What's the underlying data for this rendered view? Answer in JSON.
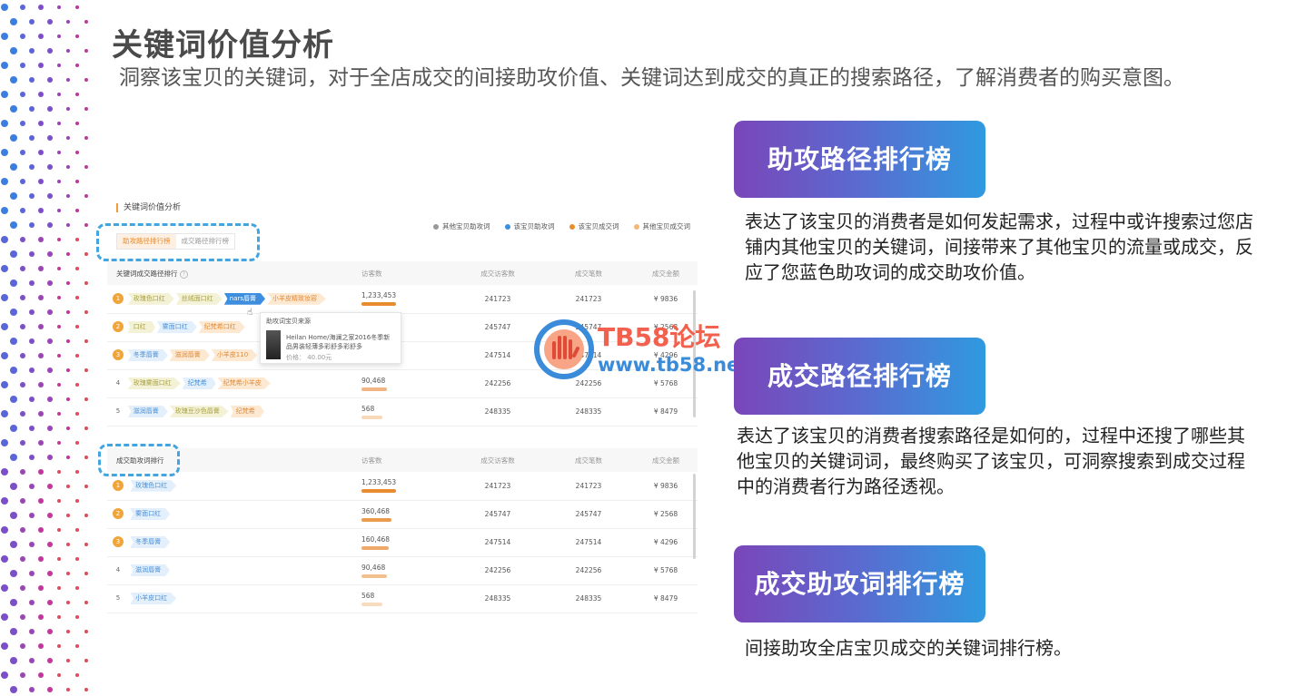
{
  "slide": {
    "title": "关键词价值分析",
    "subtitle": "洞察该宝贝的关键词，对于全店成交的间接助攻价值、关键词达到成交的真正的搜索路径，了解消费者的购买意图。"
  },
  "panel": {
    "title": "关键词价值分析",
    "legend": [
      {
        "label": "其他宝贝助攻词",
        "color": "#999999"
      },
      {
        "label": "该宝贝助攻词",
        "color": "#3d8ede"
      },
      {
        "label": "该宝贝成交词",
        "color": "#e98b2f"
      },
      {
        "label": "其他宝贝成交词",
        "color": "#f2b87a"
      }
    ],
    "tabs": [
      "助攻路径排行榜",
      "成交路径排行榜"
    ],
    "table1": {
      "columns": [
        "关键词成交路径排行",
        "访客数",
        "成交访客数",
        "成交笔数",
        "成交金额"
      ],
      "rows": [
        {
          "rank": "1",
          "chips": [
            [
              "玫瑰色口红",
              "g"
            ],
            [
              "丝绒面口红",
              "g"
            ],
            [
              "nars唇膏",
              "bb"
            ],
            [
              "小羊皮精致妆容",
              "o"
            ]
          ],
          "visitors": "1,233,453",
          "bar": 1.0,
          "buyers": "241723",
          "orders": "241723",
          "amount": "¥ 9836"
        },
        {
          "rank": "2",
          "chips": [
            [
              "口红",
              "g"
            ],
            [
              "雾面口红",
              "b"
            ],
            [
              "纪梵希口红",
              "o"
            ]
          ],
          "visitors": "",
          "bar": 0,
          "buyers": "245747",
          "orders": "245747",
          "amount": "¥ 2568"
        },
        {
          "rank": "3",
          "chips": [
            [
              "冬季唇膏",
              "b"
            ],
            [
              "滋润唇膏",
              "o"
            ],
            [
              "小羊皮110",
              "o"
            ]
          ],
          "visitors": "",
          "bar": 0,
          "buyers": "247514",
          "orders": "247514",
          "amount": "¥ 4296"
        },
        {
          "rank": "4",
          "chips": [
            [
              "玫瑰雾面口红",
              "g"
            ],
            [
              "纪梵希",
              "b"
            ],
            [
              "纪梵希小羊皮",
              "o"
            ]
          ],
          "visitors": "90,468",
          "bar": 0.73,
          "buyers": "242256",
          "orders": "242256",
          "amount": "¥ 5768"
        },
        {
          "rank": "5",
          "chips": [
            [
              "滋润唇膏",
              "b"
            ],
            [
              "玫瑰豆沙色唇膏",
              "g"
            ],
            [
              "纪梵希",
              "o"
            ]
          ],
          "visitors": "568",
          "bar": 0.6,
          "buyers": "248335",
          "orders": "248335",
          "amount": "¥ 8479"
        }
      ]
    },
    "tooltip": {
      "title": "助攻词宝贝来源",
      "product": "Heilan Home/海澜之家2016冬季新品男装轻薄多彩舒多彩舒多",
      "price": "价格： 40.00元"
    },
    "table2": {
      "columns": [
        "成交助攻词排行",
        "访客数",
        "成交访客数",
        "成交笔数",
        "成交金额"
      ],
      "rows": [
        {
          "rank": "1",
          "chip": "玫瑰色口红",
          "visitors": "1,233,453",
          "bar": 1.0,
          "buyers": "241723",
          "orders": "241723",
          "amount": "¥ 9836"
        },
        {
          "rank": "2",
          "chip": "雾面口红",
          "visitors": "360,468",
          "bar": 0.86,
          "buyers": "245747",
          "orders": "245747",
          "amount": "¥ 2568"
        },
        {
          "rank": "3",
          "chip": "冬季唇膏",
          "visitors": "160,468",
          "bar": 0.8,
          "buyers": "247514",
          "orders": "247514",
          "amount": "¥ 4296"
        },
        {
          "rank": "4",
          "chip": "滋润唇膏",
          "visitors": "90,468",
          "bar": 0.73,
          "buyers": "242256",
          "orders": "242256",
          "amount": "¥ 5768"
        },
        {
          "rank": "5",
          "chip": "小羊皮口红",
          "visitors": "568",
          "bar": 0.6,
          "buyers": "248335",
          "orders": "248335",
          "amount": "¥ 8479"
        }
      ]
    }
  },
  "cards": [
    {
      "title": "助攻路径排行榜",
      "desc": "表达了该宝贝的消费者是如何发起需求，过程中或许搜索过您店铺内其他宝贝的关键词，间接带来了其他宝贝的流量或成交，反应了您蓝色助攻词的成交助攻价值。"
    },
    {
      "title": "成交路径排行榜",
      "desc": "表达了该宝贝的消费者搜索路径是如何的，过程中还搜了哪些其他宝贝的关键词词，最终购买了该宝贝，可洞察搜索到成交过程中的消费者行为路径透视。"
    },
    {
      "title": "成交助攻词排行榜",
      "desc": "间接助攻全店宝贝成交的关键词排行榜。"
    }
  ],
  "watermark": {
    "line1": "TB58论坛",
    "line2": "www.tb58.net"
  }
}
